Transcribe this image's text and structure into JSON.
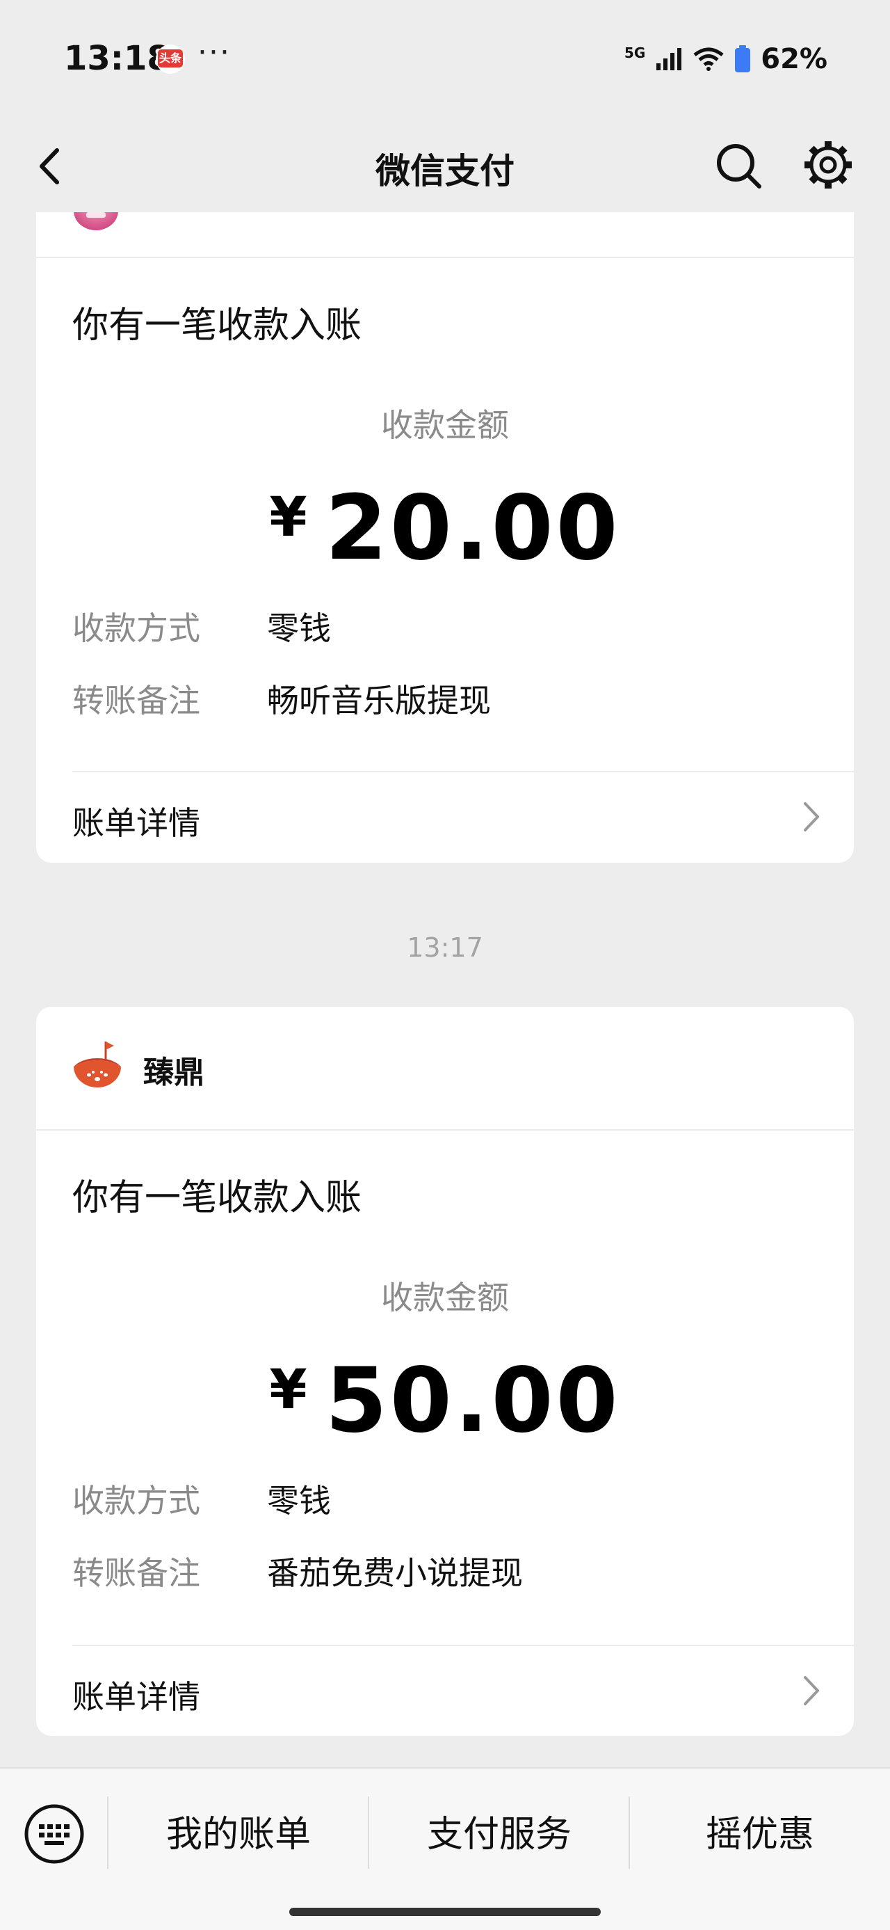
{
  "status": {
    "time": "13:18",
    "app_badge": "头条",
    "dots": "···",
    "network": "5G",
    "battery": "62%"
  },
  "nav": {
    "title": "微信支付"
  },
  "cards": [
    {
      "notice": "你有一笔收款入账",
      "amount_label": "收款金额",
      "currency": "¥",
      "amount": "20.00",
      "method_label": "收款方式",
      "method_value": "零钱",
      "memo_label": "转账备注",
      "memo_value": "畅听音乐版提现",
      "detail": "账单详情"
    },
    {
      "merchant": "臻鼎",
      "notice": "你有一笔收款入账",
      "amount_label": "收款金额",
      "currency": "¥",
      "amount": "50.00",
      "method_label": "收款方式",
      "method_value": "零钱",
      "memo_label": "转账备注",
      "memo_value": "番茄免费小说提现",
      "detail": "账单详情"
    }
  ],
  "timestamp": "13:17",
  "bottom": {
    "tabs": [
      "我的账单",
      "支付服务",
      "摇优惠"
    ]
  },
  "colors": {
    "background": "#ededed",
    "card": "#ffffff",
    "muted_text": "#8a8a8a",
    "merchant_logo": "#e0542e"
  }
}
